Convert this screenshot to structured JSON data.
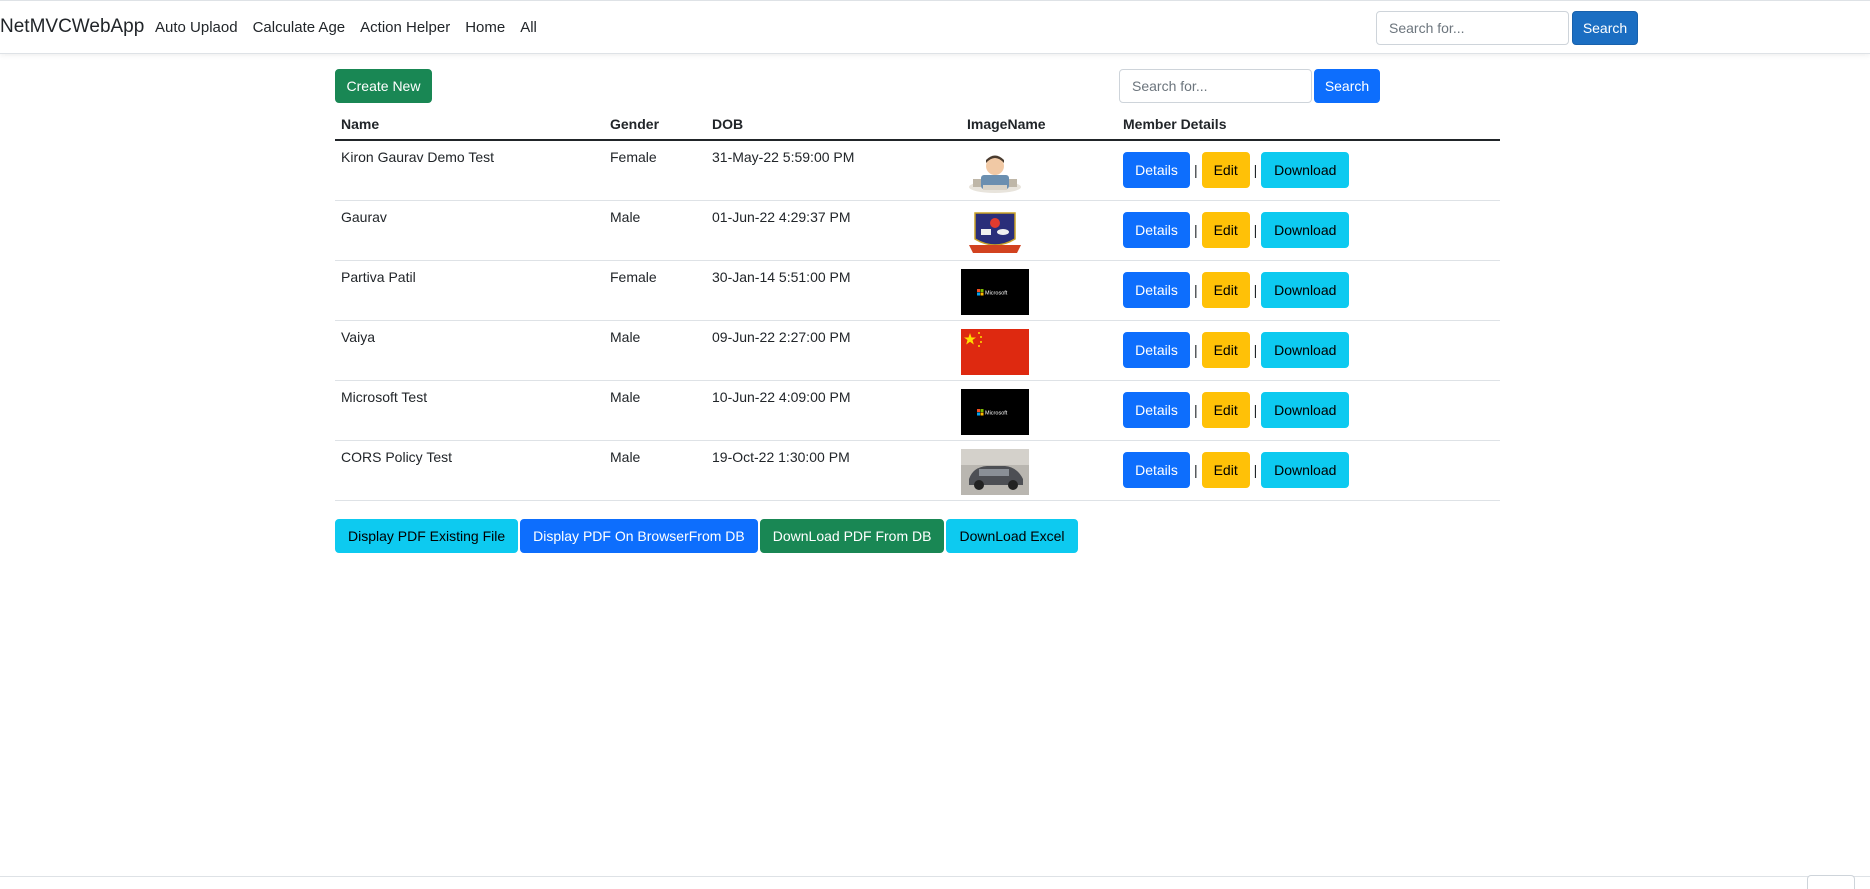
{
  "navbar": {
    "brand": "NetMVCWebApp",
    "links": [
      "Auto Uplaod",
      "Calculate Age",
      "Action Helper",
      "Home",
      "All"
    ],
    "search_placeholder": "Search for...",
    "search_button": "Search",
    "accent_color": "#1b6ec2"
  },
  "toolbar": {
    "create_label": "Create New",
    "search_placeholder": "Search for...",
    "search_button": "Search"
  },
  "table": {
    "headers": [
      "Name",
      "Gender",
      "DOB",
      "ImageName",
      "Member Details"
    ],
    "rows": [
      {
        "name": "Kiron Gaurav Demo Test",
        "gender": "Female",
        "dob": "31-May-22 5:59:00 PM",
        "image": "cartoon-person-icon"
      },
      {
        "name": "Gaurav",
        "gender": "Male",
        "dob": "01-Jun-22 4:29:37 PM",
        "image": "emblem-icon"
      },
      {
        "name": "Partiva Patil",
        "gender": "Female",
        "dob": "30-Jan-14 5:51:00 PM",
        "image": "microsoft-logo-icon"
      },
      {
        "name": "Vaiya",
        "gender": "Male",
        "dob": "09-Jun-22 2:27:00 PM",
        "image": "china-flag-icon"
      },
      {
        "name": "Microsoft Test",
        "gender": "Male",
        "dob": "10-Jun-22 4:09:00 PM",
        "image": "microsoft-logo-icon"
      },
      {
        "name": "CORS Policy Test",
        "gender": "Male",
        "dob": "19-Oct-22 1:30:00 PM",
        "image": "car-photo-icon"
      }
    ],
    "row_actions": {
      "details": "Details",
      "edit": "Edit",
      "download": "Download",
      "separator": "|"
    },
    "microsoft_thumb_text": "Microsoft"
  },
  "bottom_actions": [
    "Display PDF Existing File",
    "Display PDF On BrowserFrom DB",
    "DownLoad PDF From DB",
    "DownLoad Excel"
  ],
  "colors": {
    "success": "#198754",
    "primary": "#0d6efd",
    "warning": "#ffc107",
    "info": "#0dcaf0"
  }
}
